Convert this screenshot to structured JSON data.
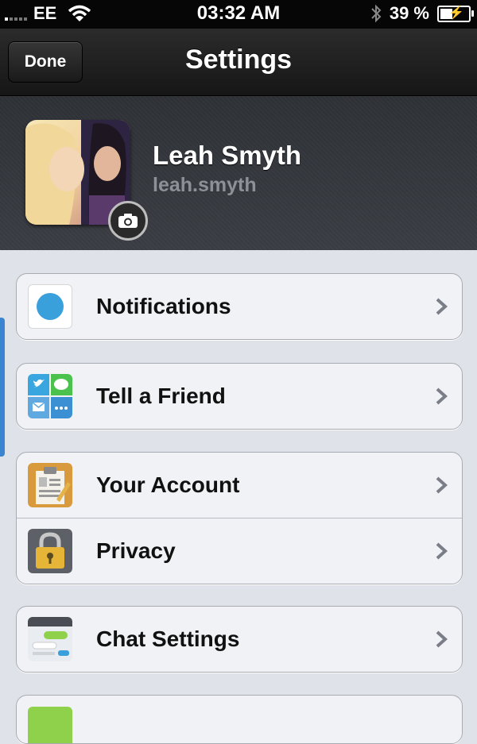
{
  "status_bar": {
    "carrier": "EE",
    "time": "03:32 AM",
    "battery_percent": "39 %",
    "battery_level": 0.39
  },
  "navbar": {
    "done_label": "Done",
    "title": "Settings"
  },
  "profile": {
    "name": "Leah Smyth",
    "username": "leah.smyth"
  },
  "settings": {
    "notifications": "Notifications",
    "tell_a_friend": "Tell a Friend",
    "your_account": "Your Account",
    "privacy": "Privacy",
    "chat_settings": "Chat Settings"
  },
  "colors": {
    "accent_blue": "#3aa0dc",
    "row_background": "#f1f2f6",
    "nav_background": "#1e1e1e"
  }
}
